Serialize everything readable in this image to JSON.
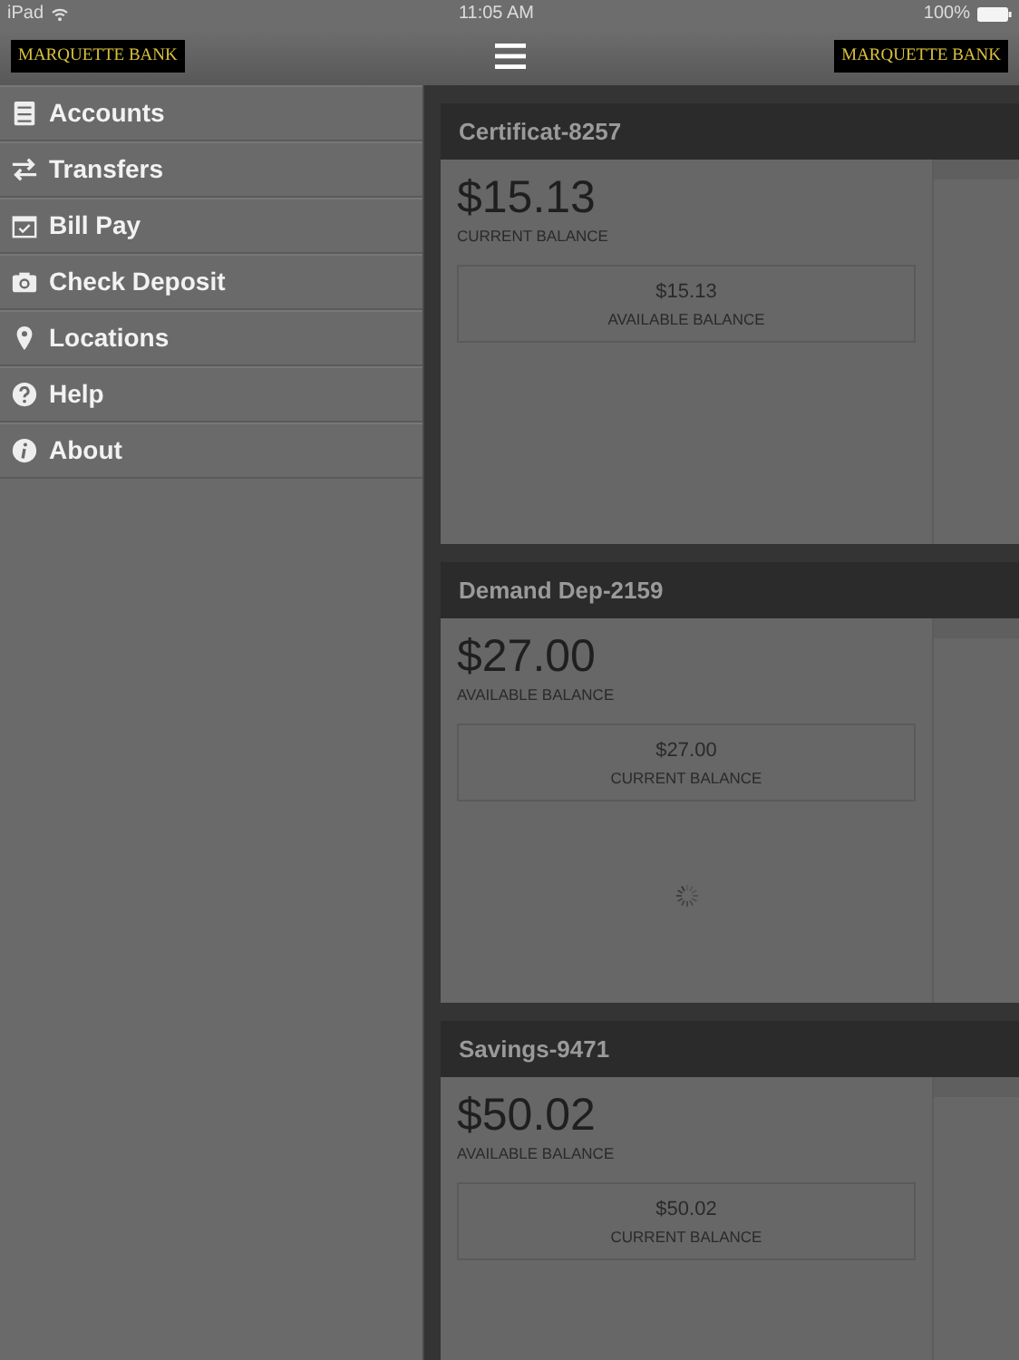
{
  "status_bar": {
    "device": "iPad",
    "time": "11:05 AM",
    "battery": "100%"
  },
  "navbar": {
    "logo_left": "MARQUETTE BANK",
    "logo_right": "MARQUETTE BANK"
  },
  "sidebar": {
    "items": [
      {
        "label": "Accounts",
        "kind": "cabinet"
      },
      {
        "label": "Transfers",
        "kind": "arrows"
      },
      {
        "label": "Bill Pay",
        "kind": "calendar"
      },
      {
        "label": "Check Deposit",
        "kind": "camera"
      },
      {
        "label": "Locations",
        "kind": "pin"
      },
      {
        "label": "Help",
        "kind": "question"
      },
      {
        "label": "About",
        "kind": "info"
      }
    ]
  },
  "accounts": [
    {
      "name": "Certificat-8257",
      "amount": "$15.13",
      "amount_label": "CURRENT BALANCE",
      "secondary_amount": "$15.13",
      "secondary_label": "AVAILABLE BALANCE",
      "loading": false
    },
    {
      "name": "Demand Dep-2159",
      "amount": "$27.00",
      "amount_label": "AVAILABLE BALANCE",
      "secondary_amount": "$27.00",
      "secondary_label": "CURRENT BALANCE",
      "loading": true
    },
    {
      "name": "Savings-9471",
      "amount": "$50.02",
      "amount_label": "AVAILABLE BALANCE",
      "secondary_amount": "$50.02",
      "secondary_label": "CURRENT BALANCE",
      "loading": false
    }
  ]
}
